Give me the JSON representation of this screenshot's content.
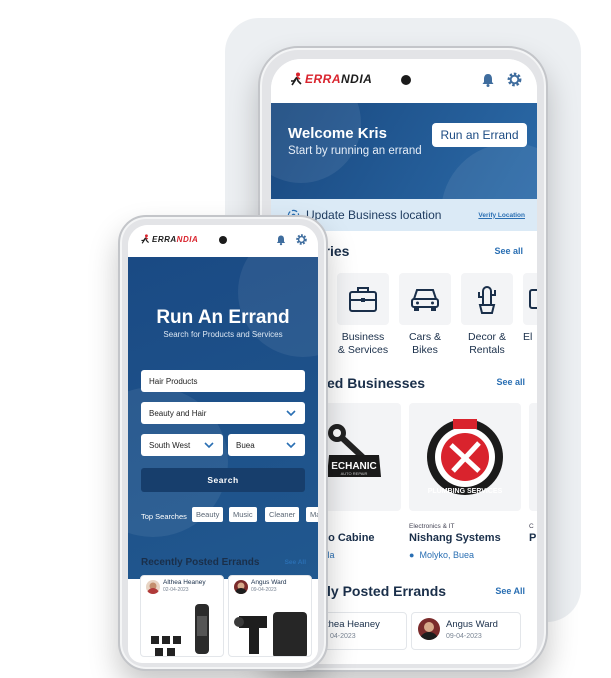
{
  "brand": {
    "logo_red": "ERRA",
    "logo_black": "NDIA",
    "red": "#d9232d",
    "blue": "#19487f"
  },
  "back_phone": {
    "welcome_title": "Welcome Kris",
    "welcome_subtitle": "Start by running an errand",
    "run_errand_button": "Run an Errand",
    "location_text": "Update Business location",
    "verify_link": "Verify Location",
    "categories_title": "ories",
    "categories_see_all": "See all",
    "categories": [
      {
        "label_1": "Business",
        "label_2": "& Services",
        "icon": "briefcase-icon"
      },
      {
        "label_1": "Cars &",
        "label_2": "Bikes",
        "icon": "car-icon"
      },
      {
        "label_1": "Decor &",
        "label_2": "Rentals",
        "icon": "cactus-icon"
      },
      {
        "label_1": "El",
        "label_2": "",
        "icon": "electronics-icon"
      }
    ],
    "businesses_title": "ed Businesses",
    "businesses_see_all": "See all",
    "businesses": [
      {
        "logo_text": "ECHANIC",
        "logo_sub": "AUTO REPAIR",
        "category": "",
        "name": "e Auto Cabine",
        "location": ", Douala"
      },
      {
        "logo_text": "PLUMBING SERVICES",
        "category": "Electronics & IT",
        "name": "Nishang Systems",
        "location": "Molyko, Buea"
      },
      {
        "category": "C",
        "name": "P",
        "location": ""
      }
    ],
    "errands_title": "ly Posted Errands",
    "errands_see_all": "See All",
    "errands": [
      {
        "name": "thea Heaney",
        "date": "04-2023"
      },
      {
        "name": "Angus Ward",
        "date": "09-04-2023"
      }
    ]
  },
  "front_phone": {
    "title": "Run An Errand",
    "subtitle": "Search for Products and Services",
    "product_input": "Hair Products",
    "category_select": "Beauty and Hair",
    "region_select": "South West",
    "city_select": "Buea",
    "search_button": "Search",
    "top_searches_label": "Top Searches",
    "top_searches": [
      "Beauty",
      "Music",
      "Cleaner",
      "Ma"
    ],
    "errands_title": "Recently Posted Errands",
    "errands_see_all": "See All",
    "errands": [
      {
        "name": "Althea Heaney",
        "date": "02-04-2023"
      },
      {
        "name": "Angus Ward",
        "date": "09-04-2023"
      }
    ]
  }
}
